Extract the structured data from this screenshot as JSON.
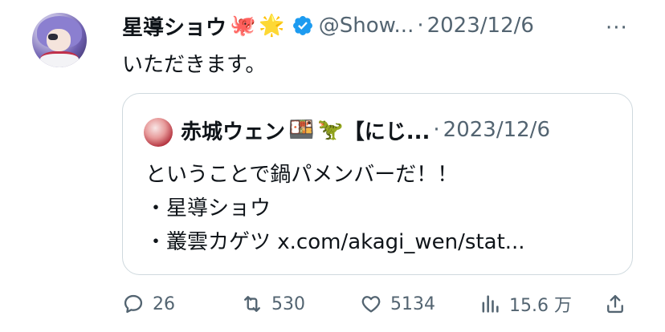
{
  "tweet": {
    "author_name": "星導ショウ",
    "author_emojis": [
      "🐙",
      "🌟"
    ],
    "handle": "@Show...",
    "separator": "·",
    "date": "2023/12/6",
    "more_label": "···",
    "text": "いただきます。"
  },
  "quote": {
    "author_name": "赤城ウェン",
    "author_emojis": [
      "🍱",
      "🦖"
    ],
    "author_suffix": "【にじ...",
    "separator": "·",
    "date": "2023/12/6",
    "lines": [
      "ということで鍋パメンバーだ！！",
      "・星導ショウ",
      "・叢雲カゲツ x.com/akagi_wen/stat..."
    ]
  },
  "actions": {
    "replies": "26",
    "reposts": "530",
    "likes": "5134",
    "views": "15.6 万"
  },
  "colors": {
    "text": "#0f1419",
    "secondary": "#536471",
    "verified": "#1d9bf0",
    "border": "#cfd9de"
  },
  "icons": [
    "octopus-emoji",
    "star-emoji",
    "verified-badge-icon",
    "more-icon",
    "bento-emoji",
    "dinosaur-emoji",
    "reply-icon",
    "repost-icon",
    "like-icon",
    "views-icon",
    "share-icon"
  ]
}
